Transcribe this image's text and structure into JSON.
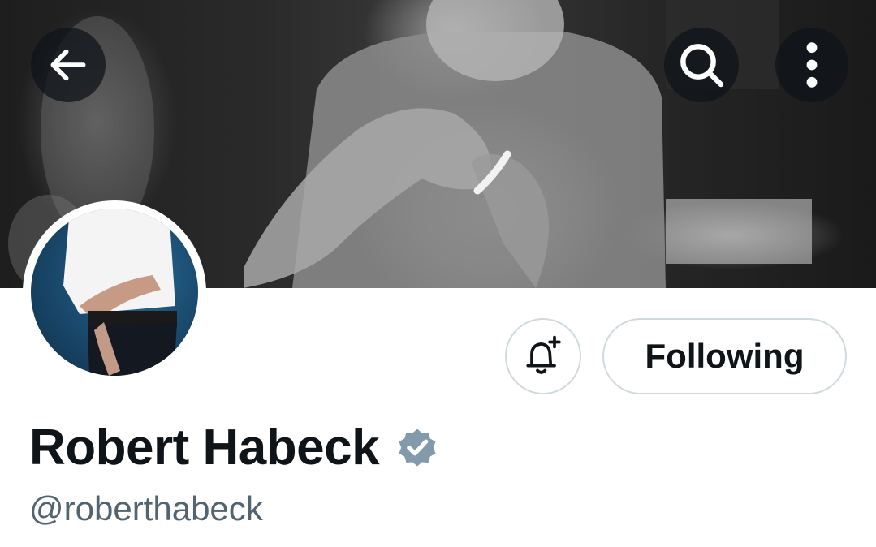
{
  "header": {
    "back_icon": "arrow-left-icon",
    "search_icon": "search-icon",
    "more_icon": "more-vertical-icon"
  },
  "profile": {
    "display_name": "Robert Habeck",
    "handle": "@roberthabeck",
    "verified_badge": "verified-badge-icon",
    "verified_color": "#829aab"
  },
  "actions": {
    "notify_icon": "bell-plus-icon",
    "following_label": "Following"
  },
  "colors": {
    "text_primary": "#0f1419",
    "text_secondary": "#536471",
    "border": "#cfd9de"
  }
}
